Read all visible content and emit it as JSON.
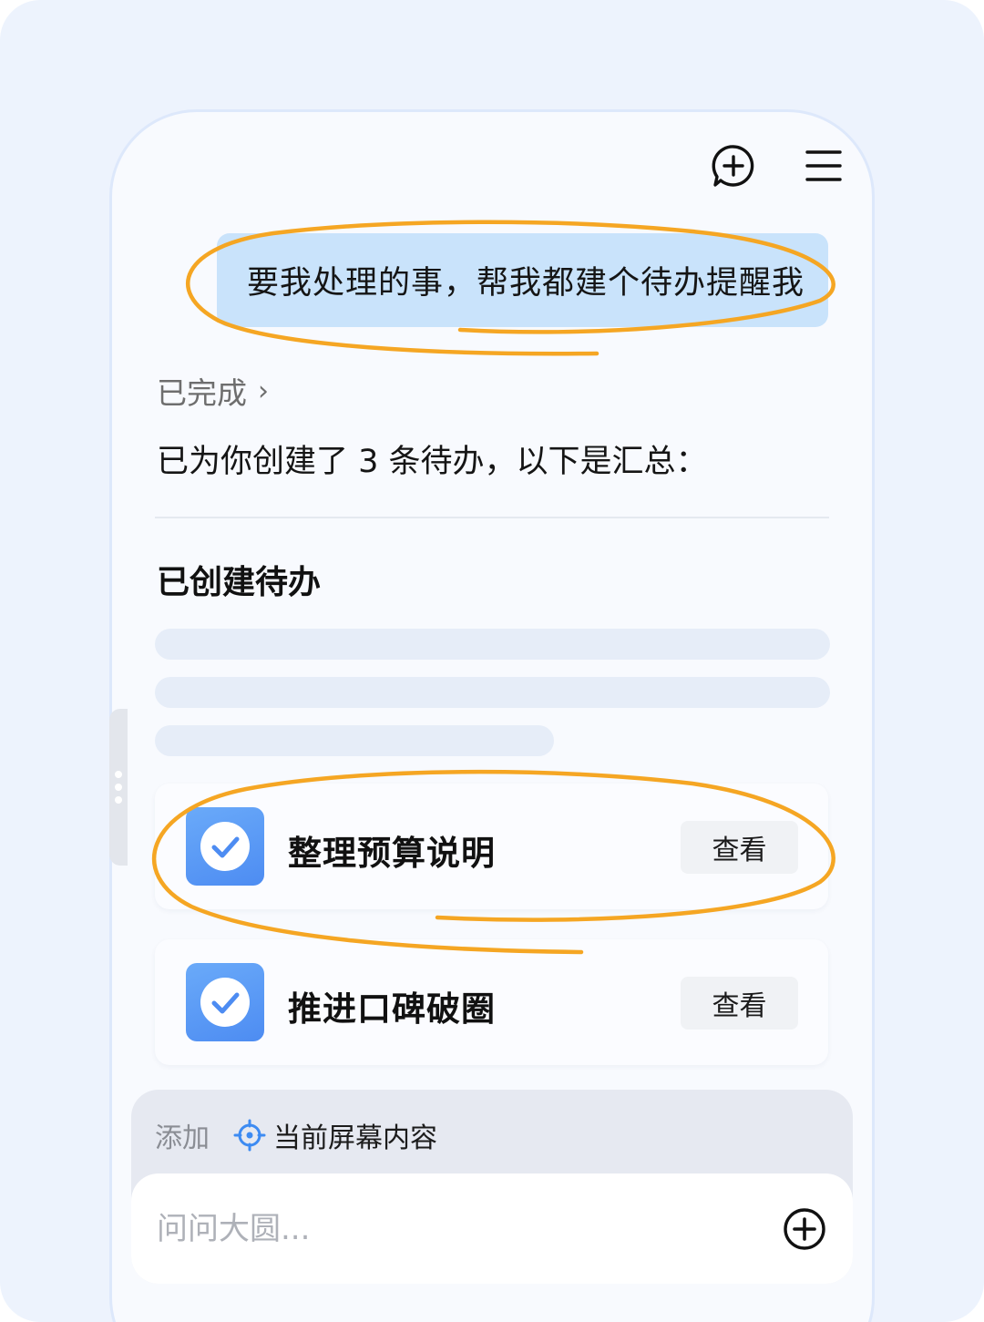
{
  "header": {
    "new_chat_icon": "new-chat-icon",
    "menu_icon": "menu-icon"
  },
  "chat": {
    "user_message": "要我处理的事，帮我都建个待办提醒我",
    "status_label": "已完成",
    "status_chevron": "›",
    "summary_text": "已为你创建了 3 条待办，以下是汇总："
  },
  "todos": {
    "section_title": "已创建待办",
    "items": [
      {
        "title": "整理预算说明",
        "action_label": "查看",
        "icon": "check-circle-icon"
      },
      {
        "title": "推进口碑破圈",
        "action_label": "查看",
        "icon": "check-circle-icon"
      }
    ]
  },
  "composer": {
    "add_label": "添加",
    "context_chip_label": "当前屏幕内容",
    "context_chip_icon": "crosshair-target-icon",
    "input_placeholder": "问问大圆...",
    "plus_icon": "plus-circle-icon"
  },
  "colors": {
    "background": "#edf3fd",
    "user_bubble": "#c9e3fb",
    "todo_icon": "#5b9af6",
    "annotation_highlight": "#f5a623",
    "chip_icon": "#3d8bf2"
  }
}
